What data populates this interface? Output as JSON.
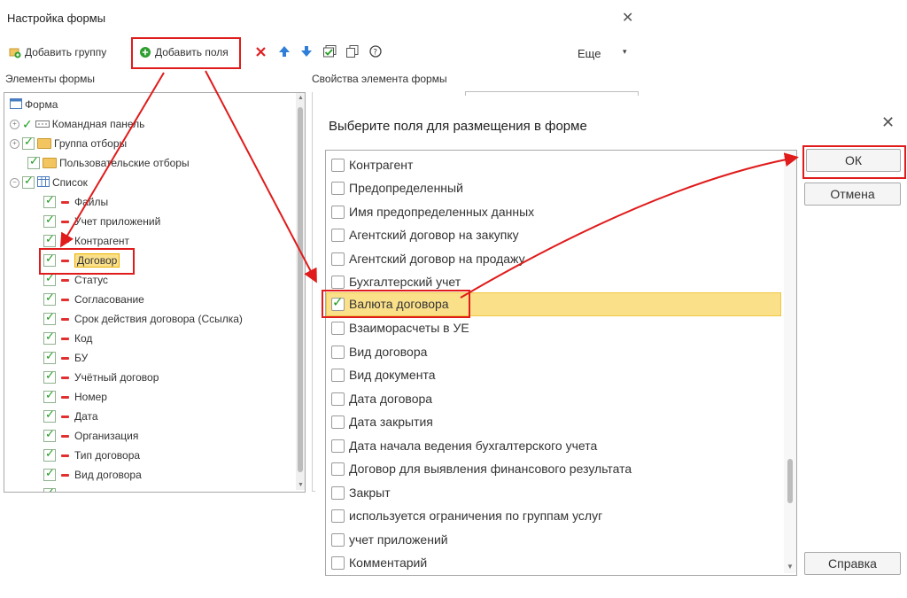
{
  "window": {
    "title": "Настройка формы"
  },
  "toolbar": {
    "add_group_label": "Добавить группу",
    "add_field_label": "Добавить поля",
    "more_label": "Еще"
  },
  "left": {
    "header": "Элементы формы",
    "tree": [
      {
        "label": "Форма",
        "icon": "form-icon"
      },
      {
        "label": "Командная панель",
        "icon": "command-panel-icon"
      },
      {
        "label": "Группа отборы",
        "icon": "folder-icon"
      },
      {
        "label": "Пользовательские отборы",
        "icon": "folder-icon"
      },
      {
        "label": "Список",
        "icon": "table-icon"
      },
      {
        "label": "Файлы"
      },
      {
        "label": "Учет приложений"
      },
      {
        "label": "Контрагент"
      },
      {
        "label": "Договор"
      },
      {
        "label": "Статус"
      },
      {
        "label": "Согласование"
      },
      {
        "label": "Срок действия договора (Ссылка)"
      },
      {
        "label": "Код"
      },
      {
        "label": "БУ"
      },
      {
        "label": "Учётный договор"
      },
      {
        "label": "Номер"
      },
      {
        "label": "Дата"
      },
      {
        "label": "Организация"
      },
      {
        "label": "Тип договора"
      },
      {
        "label": "Вид договора"
      }
    ]
  },
  "right": {
    "header": "Свойства элемента формы"
  },
  "dialog": {
    "title": "Выберите поля для размещения в форме",
    "items": [
      {
        "label": "Контрагент",
        "checked": false
      },
      {
        "label": "Предопределенный",
        "checked": false
      },
      {
        "label": "Имя предопределенных данных",
        "checked": false
      },
      {
        "label": "Агентский договор на закупку",
        "checked": false
      },
      {
        "label": "Агентский договор на продажу",
        "checked": false
      },
      {
        "label": "Бухгалтерский учет",
        "checked": false
      },
      {
        "label": "Валюта договора",
        "checked": true
      },
      {
        "label": "Взаиморасчеты в УЕ",
        "checked": false
      },
      {
        "label": "Вид договора",
        "checked": false
      },
      {
        "label": "Вид документа",
        "checked": false
      },
      {
        "label": "Дата договора",
        "checked": false
      },
      {
        "label": "Дата закрытия",
        "checked": false
      },
      {
        "label": "Дата начала ведения бухгалтерского учета",
        "checked": false
      },
      {
        "label": "Договор для выявления финансового результата",
        "checked": false
      },
      {
        "label": "Закрыт",
        "checked": false
      },
      {
        "label": "используется ограничения по группам услуг",
        "checked": false
      },
      {
        "label": "учет приложений",
        "checked": false
      },
      {
        "label": "Комментарий",
        "checked": false
      }
    ],
    "ok_label": "ОК",
    "cancel_label": "Отмена",
    "help_label": "Справка"
  },
  "colors": {
    "annotation_red": "#e01b1b",
    "selection_yellow": "#fbe08a",
    "check_green": "#1e9e1e"
  }
}
